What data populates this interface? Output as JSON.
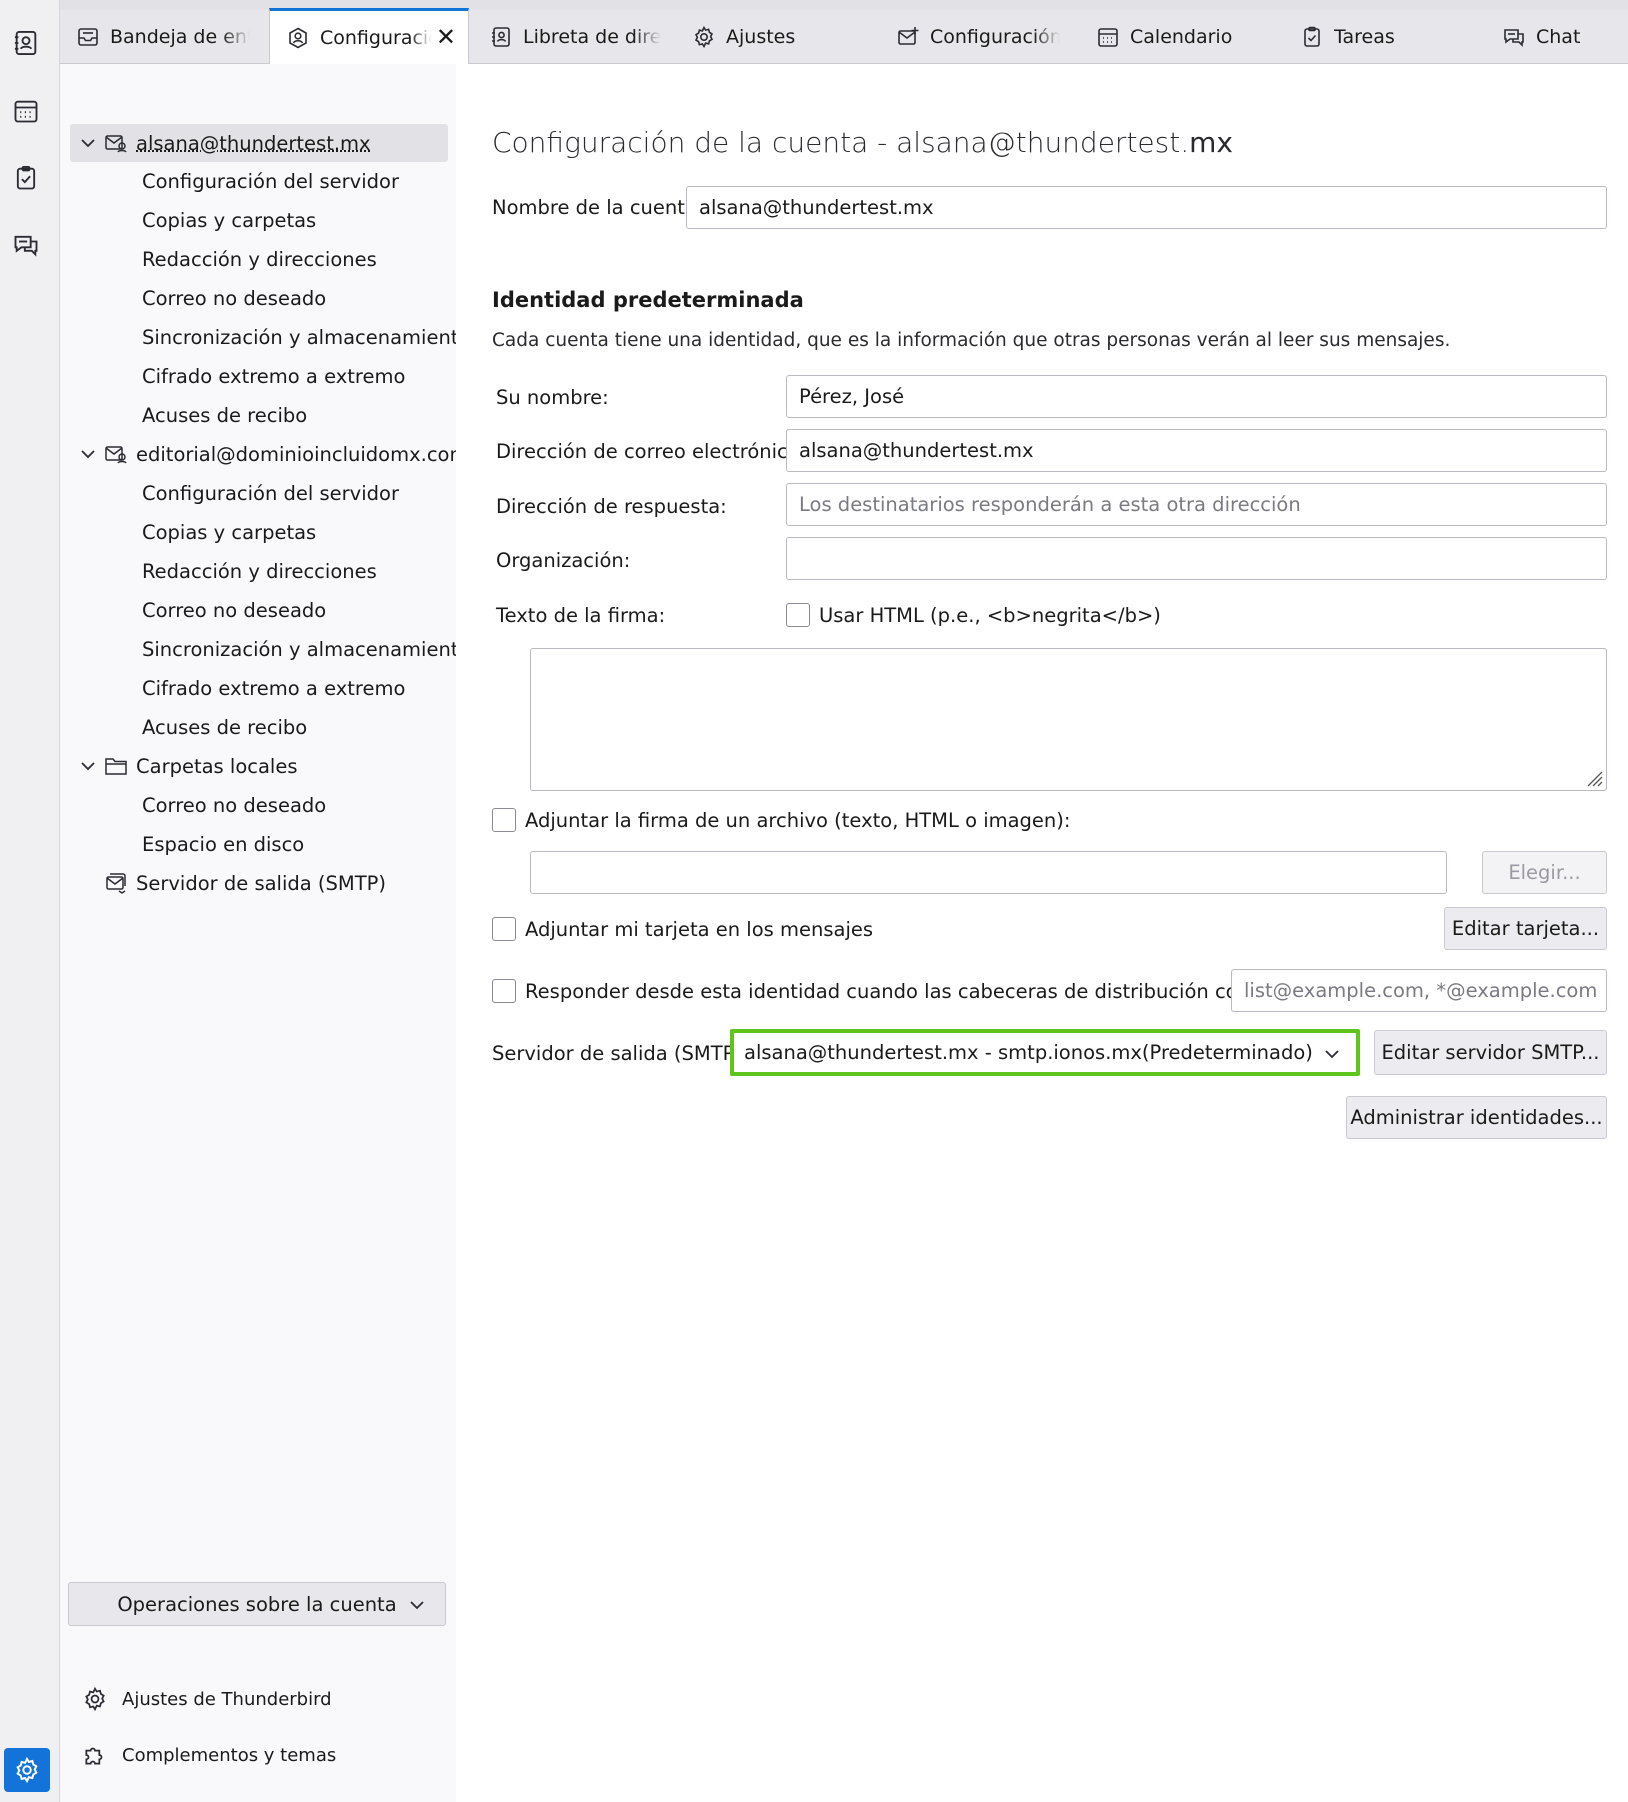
{
  "tabs": [
    {
      "label": "Bandeja de entrada",
      "icon": "inbox-icon"
    },
    {
      "label": "Configuración de la cuenta",
      "icon": "account-settings-icon",
      "active": true
    },
    {
      "label": "Libreta de direcciones",
      "icon": "address-book-icon"
    },
    {
      "label": "Ajustes",
      "icon": "gear-icon"
    },
    {
      "label": "Configuración de la cuenta de correo",
      "icon": "mail-setup-icon"
    },
    {
      "label": "Calendario",
      "icon": "calendar-icon"
    },
    {
      "label": "Tareas",
      "icon": "tasks-icon"
    },
    {
      "label": "Chat",
      "icon": "chat-icon"
    }
  ],
  "sidebar": {
    "account1": {
      "name": "alsana@thundertest.mx",
      "children": [
        "Configuración del servidor",
        "Copias y carpetas",
        "Redacción y direcciones",
        "Correo no deseado",
        "Sincronización y almacenamiento",
        "Cifrado extremo a extremo",
        "Acuses de recibo"
      ]
    },
    "account2": {
      "name": "editorial@dominioincluidomx.com",
      "children": [
        "Configuración del servidor",
        "Copias y carpetas",
        "Redacción y direcciones",
        "Correo no deseado",
        "Sincronización y almacenamiento",
        "Cifrado extremo a extremo",
        "Acuses de recibo"
      ]
    },
    "local": {
      "name": "Carpetas locales",
      "children": [
        "Correo no deseado",
        "Espacio en disco"
      ]
    },
    "smtp": "Servidor de salida (SMTP)",
    "account_ops": "Operaciones sobre la cuenta",
    "footer": [
      "Ajustes de Thunderbird",
      "Complementos y temas"
    ]
  },
  "main": {
    "title_prefix": "Configuración de la cuenta - alsana@thundertest.",
    "title_suffix": "mx",
    "account_name_label": "Nombre de la cuenta:",
    "account_name_value": "alsana@thundertest.mx",
    "identity_heading": "Identidad predeterminada",
    "identity_desc": "Cada cuenta tiene una identidad, que es la información que otras personas verán al leer sus mensajes.",
    "name_label": "Su nombre:",
    "name_value": "Pérez, José",
    "email_label": "Dirección de correo electrónico:",
    "email_value": "alsana@thundertest.mx",
    "reply_label": "Dirección de respuesta:",
    "reply_placeholder": "Los destinatarios responderán a esta otra dirección",
    "org_label": "Organización:",
    "org_value": "",
    "sig_label": "Texto de la firma:",
    "use_html_label": "Usar HTML (p.e., <b>negrita</b>)",
    "attach_sig_label": "Adjuntar la firma de un archivo (texto, HTML o imagen):",
    "choose_btn": "Elegir...",
    "attach_card_label": "Adjuntar mi tarjeta en los mensajes",
    "edit_card_btn": "Editar tarjeta...",
    "reply_from_label": "Responder desde esta identidad cuando las cabeceras de distribución coinciden:",
    "reply_from_placeholder": "list@example.com, *@example.com",
    "smtp_label": "Servidor de salida (SMTP):",
    "smtp_value": "alsana@thundertest.mx - smtp.ionos.mx(Predeterminado)",
    "edit_smtp_btn": "Editar servidor SMTP...",
    "manage_ids_btn": "Administrar identidades..."
  },
  "colors": {
    "accent": "#1373d9",
    "highlight": "#5ec51a"
  }
}
